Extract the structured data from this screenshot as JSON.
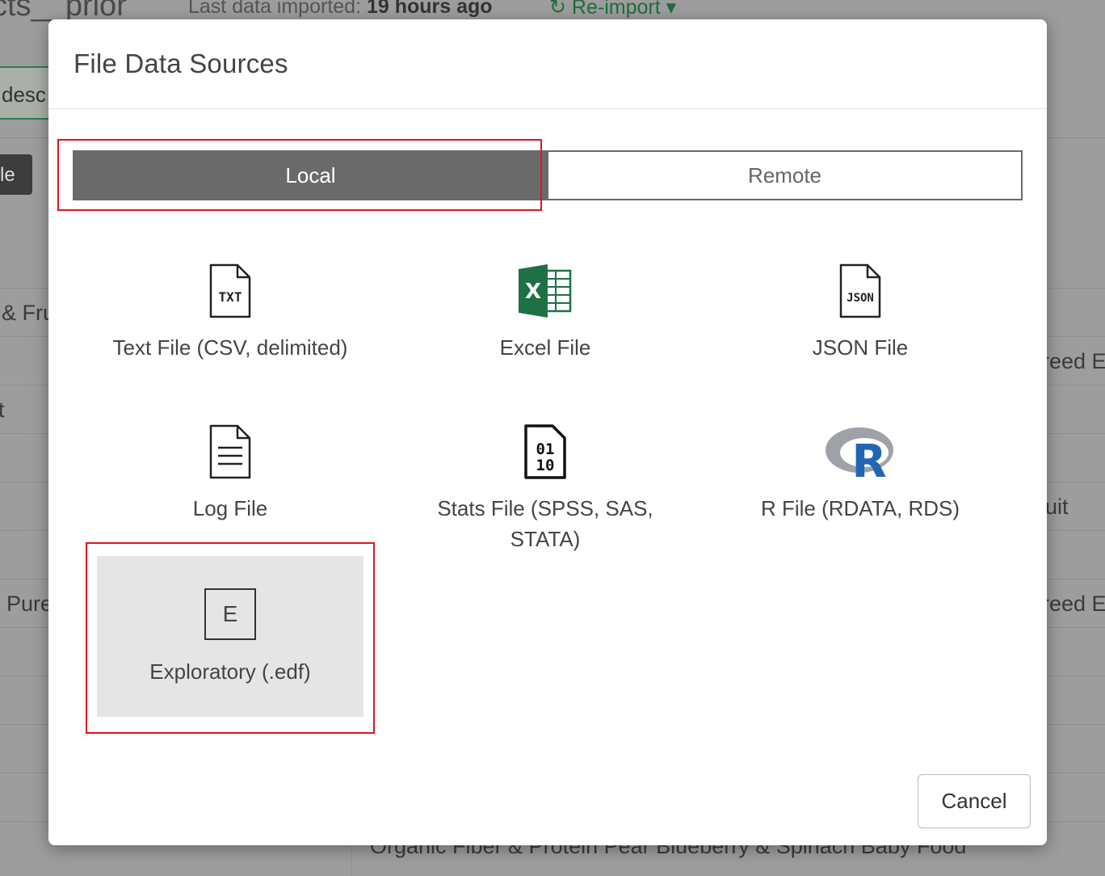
{
  "background": {
    "title_fragment": "cts__prior",
    "imported_label": "Last data imported:",
    "imported_value": "19 hours ago",
    "reimport_label": "Re-import",
    "tab_fragment": "desc",
    "button_fragment": "le",
    "cells": [
      "& Fru",
      "t",
      "Pure",
      "reed E",
      "uit",
      "reed E",
      "Organic Fiber & Protein Pear Blueberry & Spinach Baby Food"
    ]
  },
  "modal": {
    "title": "File Data Sources",
    "tabs": {
      "local": "Local",
      "remote": "Remote"
    },
    "sources": {
      "text": {
        "label": "Text File (CSV, delimited)",
        "icon": "txt-file-icon"
      },
      "excel": {
        "label": "Excel File",
        "icon": "excel-icon"
      },
      "json": {
        "label": "JSON File",
        "icon": "json-file-icon"
      },
      "log": {
        "label": "Log File",
        "icon": "log-file-icon"
      },
      "stats": {
        "label": "Stats File (SPSS, SAS, STATA)",
        "icon": "binary-file-icon"
      },
      "r": {
        "label": "R File (RDATA, RDS)",
        "icon": "r-logo-icon"
      },
      "edf": {
        "label": "Exploratory (.edf)",
        "icon_letter": "E"
      }
    },
    "cancel_label": "Cancel"
  },
  "colors": {
    "active_tab": "#6a6a6a",
    "highlight": "#e0141e",
    "excel_green": "#1e7145",
    "r_blue": "#2166b4"
  },
  "icon_glyphs": {
    "txt": "TXT",
    "json": "JSON",
    "excel": "X",
    "r": "R",
    "stats_row1": "01",
    "stats_row2": "10"
  }
}
